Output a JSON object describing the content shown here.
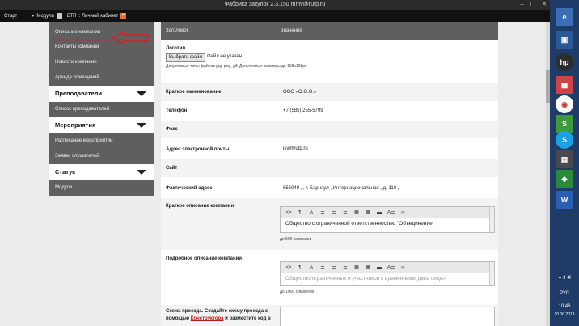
{
  "window": {
    "title": "Фабрика закупок 2.3.150 mmv@rutp.ru",
    "controls": [
      "–",
      "▢",
      "✕"
    ]
  },
  "menubar": {
    "start": "Старт",
    "modules": "Модули",
    "tab": "БТП :: Личный кабинет"
  },
  "sidebar": {
    "items": [
      {
        "label": "Описание компании",
        "type": "item"
      },
      {
        "label": "Контакты компании",
        "type": "item"
      },
      {
        "label": "Новости компании",
        "type": "item"
      },
      {
        "label": "Аренда помещений",
        "type": "item"
      },
      {
        "label": "Преподаватели",
        "type": "header"
      },
      {
        "label": "Список преподавателей",
        "type": "item"
      },
      {
        "label": "Мероприятия",
        "type": "header"
      },
      {
        "label": "Расписание мероприятий",
        "type": "item"
      },
      {
        "label": "Заявки слушателей",
        "type": "item"
      },
      {
        "label": "Статус",
        "type": "header"
      },
      {
        "label": "Модули",
        "type": "item"
      }
    ]
  },
  "table": {
    "col_name": "Заголовок",
    "col_value": "Значение",
    "logo": {
      "label": "Логотип",
      "button": "Выбрать файл",
      "status": "Файл не указан",
      "hint": "Допустимые типы файлов jpg, png, gif. Допустимые размеры до 198х198px"
    },
    "short_name": {
      "label": "Краткое наименование",
      "value": "ООО «О.О.О.»"
    },
    "phone": {
      "label": "Телефон",
      "value": "+7 (585) 255-5799"
    },
    "fax": {
      "label": "Факс",
      "value": ""
    },
    "email": {
      "label": "Адрес электронной почты",
      "value": "isv@rutp.ru"
    },
    "site": {
      "label": "Сайт",
      "value": ""
    },
    "address": {
      "label": "Фактический адрес",
      "value": "656049 ,    , г. Барнаул ,  Интернациональная ,  д. 110 ,"
    },
    "short_desc": {
      "label": "Краткое описание компании",
      "text": "Общество с ограниченной ответственностью \"Объединение",
      "counter": "до 500 символов"
    },
    "full_desc": {
      "label": "Подробное описание компании",
      "text": "Общество ограниченных и участников с временными дела сидел",
      "counter": "до 1000 символов"
    },
    "scheme": {
      "label_a": "Схема проезда. Создайте схему проезда с помощью ",
      "link": "Конструктора",
      "label_b": " и разместите код в"
    }
  },
  "editor_toolbar": [
    "<>",
    "¶",
    "A",
    "☰",
    "☰",
    "☰",
    "▦",
    "▦",
    "▬",
    "A☰",
    "∞"
  ],
  "taskbar": {
    "lang": "РУС",
    "time": "10:46",
    "date": "10.06.2013"
  },
  "colors": {
    "sidebar": "#5f5f5f",
    "taskbar": "#1f3c68",
    "arrow": "#d91e1e",
    "link": "#b71c1c"
  }
}
